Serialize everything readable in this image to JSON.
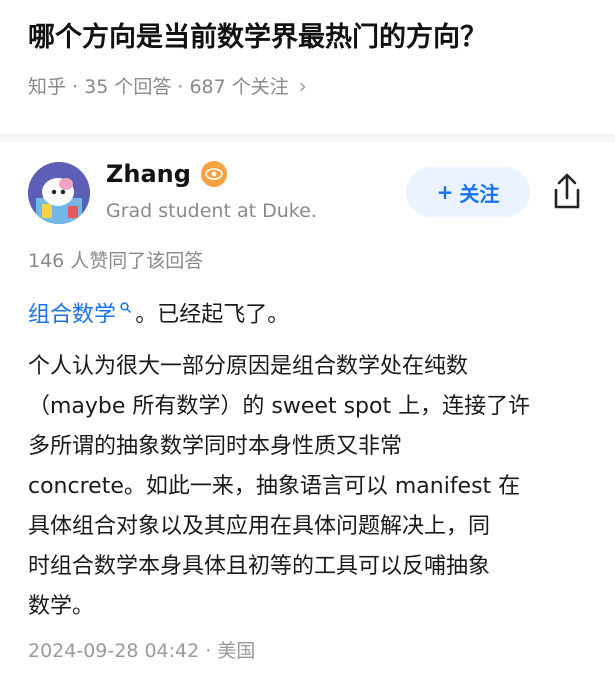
{
  "question": {
    "title": "哪个方向是当前数学界最热门的方向？",
    "meta": "知乎 · 35 个回答 · 687 个关注"
  },
  "author": {
    "name": "Zhang",
    "bio": "Grad student at Duke."
  },
  "follow_button": {
    "plus": "+",
    "label": "关注"
  },
  "vote_summary": "146 人赞同了该回答",
  "answer": {
    "topic_link": "组合数学",
    "first_line_rest": "。已经起飞了。",
    "paragraph_lines": [
      "个人认为很大一部分原因是组合数学处在纯数",
      "（maybe 所有数学）的 sweet spot 上，连接了许",
      "多所谓的抽象数学同时本身性质又非常",
      "concrete。如此一来，抽象语言可以 manifest 在",
      "具体组合对象以及其应用在具体问题解决上，同",
      "时组合数学本身具体且初等的工具可以反哺抽象",
      "数学。"
    ]
  },
  "timestamp": "2024-09-28 04:42 · 美国",
  "colors": {
    "accent": "#1772f6",
    "follow_bg": "#eaf1ff",
    "muted": "#8a8a8a",
    "badge": "#f7a23e"
  },
  "icons": [
    "chevron-right-icon",
    "eye-badge-icon",
    "share-icon",
    "search-icon"
  ]
}
